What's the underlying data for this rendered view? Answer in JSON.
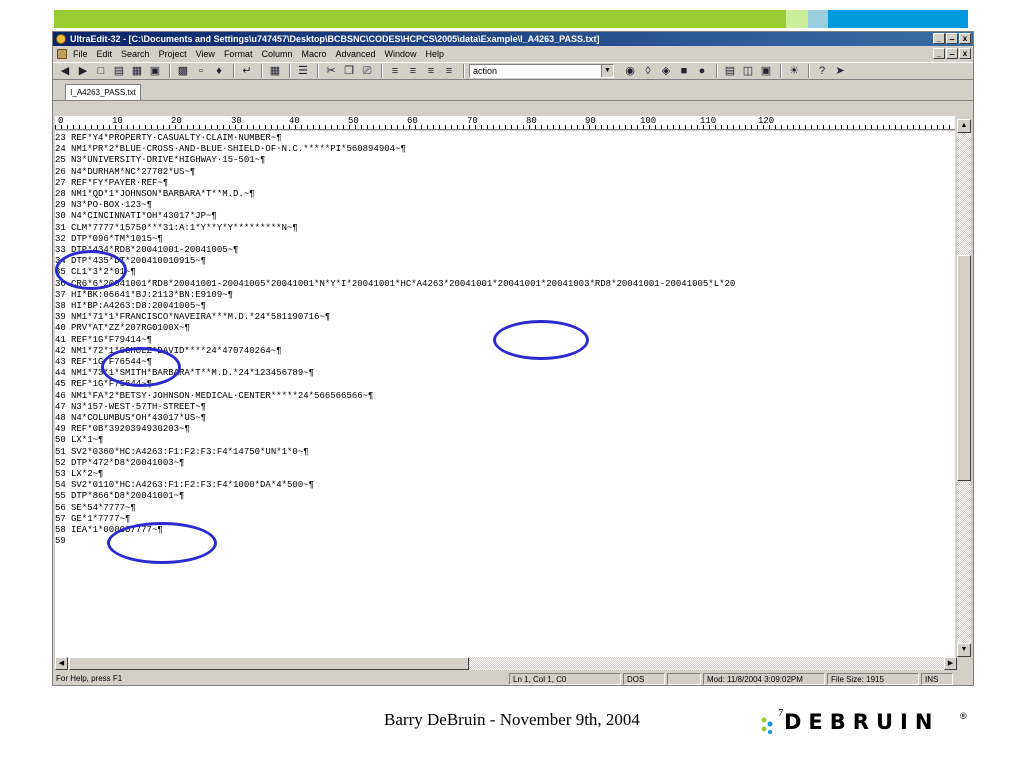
{
  "window": {
    "title": "UltraEdit-32 - [C:\\Documents and Settings\\u747457\\Desktop\\BCBSNC\\CODES\\HCPCS\\2005\\data\\Example\\I_A4263_PASS.txt]",
    "min": "_",
    "max": "̶",
    "close": "x"
  },
  "menu": {
    "items": [
      "File",
      "Edit",
      "Search",
      "Project",
      "View",
      "Format",
      "Column",
      "Macro",
      "Advanced",
      "Window",
      "Help"
    ]
  },
  "toolbar": {
    "search_value": "action",
    "icons": [
      "back-icon",
      "forward-icon",
      "new-file-icon",
      "open-icon",
      "open-folder-icon",
      "save-icon",
      "print-icon",
      "print-preview-icon",
      "spell-icon",
      "wordwrap-icon",
      "hex-icon",
      "column-icon",
      "cut-icon",
      "copy-icon",
      "paste-icon",
      "align-left-icon",
      "align-center-icon",
      "align-right-icon",
      "justify-icon"
    ]
  },
  "tab": {
    "label": "I_A4263_PASS.txt"
  },
  "ruler": {
    "marks": [
      "0",
      "10",
      "20",
      "30",
      "40",
      "50",
      "60",
      "70",
      "80",
      "90",
      "100",
      "110",
      "120"
    ]
  },
  "lines": [
    {
      "n": "23",
      "text": "REF*Y4*PROPERTY·CASUALTY·CLAIM·NUMBER~¶"
    },
    {
      "n": "24",
      "text": "NM1*PR*2*BLUE·CROSS·AND·BLUE·SHIELD·OF·N.C.*****PI*560894904~¶"
    },
    {
      "n": "25",
      "text": "N3*UNIVERSITY·DRIVE*HIGHWAY·15-501~¶"
    },
    {
      "n": "26",
      "text": "N4*DURHAM*NC*27702*US~¶"
    },
    {
      "n": "27",
      "text": "REF*FY*PAYER·REF~¶"
    },
    {
      "n": "28",
      "text": "NM1*QD*1*JOHNSON*BARBARA*T**M.D.~¶"
    },
    {
      "n": "29",
      "text": "N3*PO·BOX·123~¶"
    },
    {
      "n": "30",
      "text": "N4*CINCINNATI*OH*43017*JP~¶"
    },
    {
      "n": "31",
      "text": "CLM*7777*15750***31:A:1*Y**Y*Y*********N~¶"
    },
    {
      "n": "32",
      "text": "DTP*096*TM*1015~¶"
    },
    {
      "n": "33",
      "text": "DTP*434*RD8*20041001-20041005~¶"
    },
    {
      "n": "34",
      "text": "DTP*435*DT*200410010915~¶"
    },
    {
      "n": "35",
      "text": "CL1*3*2*01~¶"
    },
    {
      "n": "36",
      "text": "CR6*6*20041001*RD8*20041001-20041005*20041001*N*Y*I*20041001*HC*A4263*20041001*20041001*20041003*RD8*20041001-20041005*L*20"
    },
    {
      "n": "37",
      "text": "HI*BK:06641*BJ:2113*BN:E9109~¶"
    },
    {
      "n": "38",
      "text": "HI*BP:A4263:D8:20041005~¶"
    },
    {
      "n": "39",
      "text": "NM1*71*1*FRANCISCO*NAVEIRA***M.D.*24*581190716~¶"
    },
    {
      "n": "40",
      "text": "PRV*AT*ZZ*207RG0100X~¶"
    },
    {
      "n": "41",
      "text": "REF*1G*F79414~¶"
    },
    {
      "n": "42",
      "text": "NM1*72*1*SCHOLZ*DAVID****24*470740264~¶"
    },
    {
      "n": "43",
      "text": "REF*1G*F76544~¶"
    },
    {
      "n": "44",
      "text": "NM1*73*1*SMITH*BARBARA*T**M.D.*24*123456789~¶"
    },
    {
      "n": "45",
      "text": "REF*1G*F75644~¶"
    },
    {
      "n": "46",
      "text": "NM1*FA*2*BETSY·JOHNSON·MEDICAL·CENTER*****24*566566566~¶"
    },
    {
      "n": "47",
      "text": "N3*157·WEST·57TH·STREET~¶"
    },
    {
      "n": "48",
      "text": "N4*COLUMBUS*OH*43017*US~¶"
    },
    {
      "n": "49",
      "text": "REF*0B*3920394930203~¶"
    },
    {
      "n": "50",
      "text": "LX*1~¶"
    },
    {
      "n": "51",
      "text": "SV2*0360*HC:A4263:F1:F2:F3:F4*14750*UN*1*0~¶"
    },
    {
      "n": "52",
      "text": "DTP*472*D8*20041003~¶"
    },
    {
      "n": "53",
      "text": "LX*2~¶"
    },
    {
      "n": "54",
      "text": "SV2*0110*HC:A4263:F1:F2:F3:F4*1000*DA*4*500~¶"
    },
    {
      "n": "55",
      "text": "DTP*866*D8*20041001~¶"
    },
    {
      "n": "56",
      "text": "SE*54*7777~¶"
    },
    {
      "n": "57",
      "text": "GE*1*7777~¶"
    },
    {
      "n": "58",
      "text": "IEA*1*000007777~¶"
    },
    {
      "n": "59",
      "text": ""
    }
  ],
  "status": {
    "help": "For Help, press F1",
    "position": "Ln 1, Col 1, C0",
    "format": "DOS",
    "modified": "Mod: 11/8/2004 3:09:02PM",
    "filesize": "File Size: 1915",
    "mode": "INS"
  },
  "footer": {
    "author": "Barry DeBruin - November 9th, 2004",
    "page": "7",
    "logo": "DEBRUIN",
    "reg": "®"
  },
  "colors": {
    "band_lime": "#99cc33",
    "band_pale": "#ccee99",
    "band_lightblue": "#99ccdd",
    "band_blue": "#0099dd",
    "annotation": "#2b2bd0",
    "logo_dots": [
      "#99cc33",
      "#0099dd"
    ]
  }
}
